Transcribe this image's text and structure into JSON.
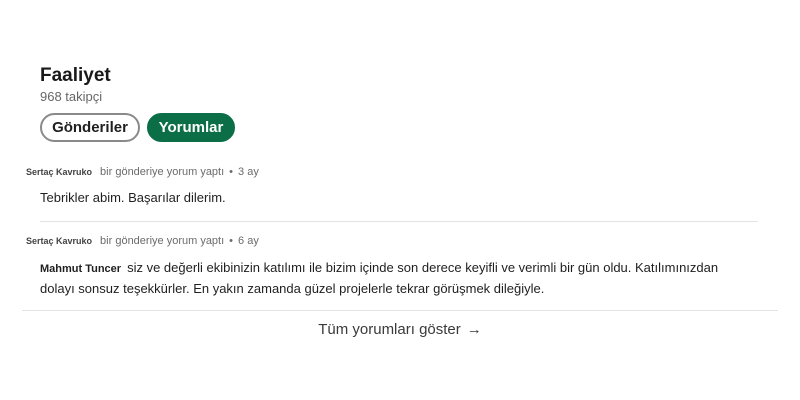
{
  "activity": {
    "title": "Faaliyet",
    "followers": "968 takipçi"
  },
  "tabs": [
    {
      "label": "Gönderiler",
      "selected": false
    },
    {
      "label": "Yorumlar",
      "selected": true
    }
  ],
  "comments": [
    {
      "author": "Sertaç Kavruko",
      "action": "bir gönderiye yorum yaptı",
      "separator": "•",
      "time": "3 ay",
      "mention": "",
      "text_line1": "Tebrikler abim. Başarılar dilerim.",
      "text_line2": ""
    },
    {
      "author": "Sertaç Kavruko",
      "action": "bir gönderiye yorum yaptı",
      "separator": "•",
      "time": "6 ay",
      "mention": "Mahmut Tuncer",
      "text_line1": "siz ve değerli ekibinizin katılımı ile bizim içinde son derece keyifli ve verimli bir gün oldu. Katılımınızdan",
      "text_line2": "dolayı sonsuz teşekkürler. En yakın zamanda güzel projelerle tekrar görüşmek dileğiyle."
    }
  ],
  "show_all": {
    "label": "Tüm yorumları göster",
    "arrow": "→"
  },
  "colors": {
    "accent": "#0b6e46",
    "text": "#1f1f1f",
    "muted": "#6b6b6b",
    "divider": "#e3e3e3"
  }
}
